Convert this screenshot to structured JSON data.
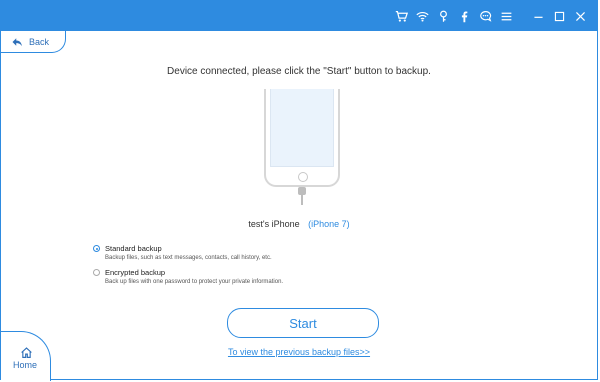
{
  "toolbar": {
    "icons": [
      "cart-icon",
      "wifi-icon",
      "key-icon",
      "facebook-icon",
      "chat-icon",
      "menu-icon"
    ],
    "window_controls": [
      "minimize-icon",
      "maximize-icon",
      "close-icon"
    ],
    "accent": "#2e8be0"
  },
  "nav": {
    "back_label": "Back",
    "home_label": "Home"
  },
  "main": {
    "headline": "Device connected, please click the \"Start\" button to backup.",
    "device_name": "test's iPhone",
    "device_model": "(iPhone 7)",
    "options": [
      {
        "label": "Standard backup",
        "description": "Backup files, such as text messages, contacts, call history, etc.",
        "selected": true
      },
      {
        "label": "Encrypted backup",
        "description": "Back up files with one password to protect your private information.",
        "selected": false
      }
    ],
    "start_label": "Start",
    "previous_link": "To view the previous backup files>>"
  }
}
